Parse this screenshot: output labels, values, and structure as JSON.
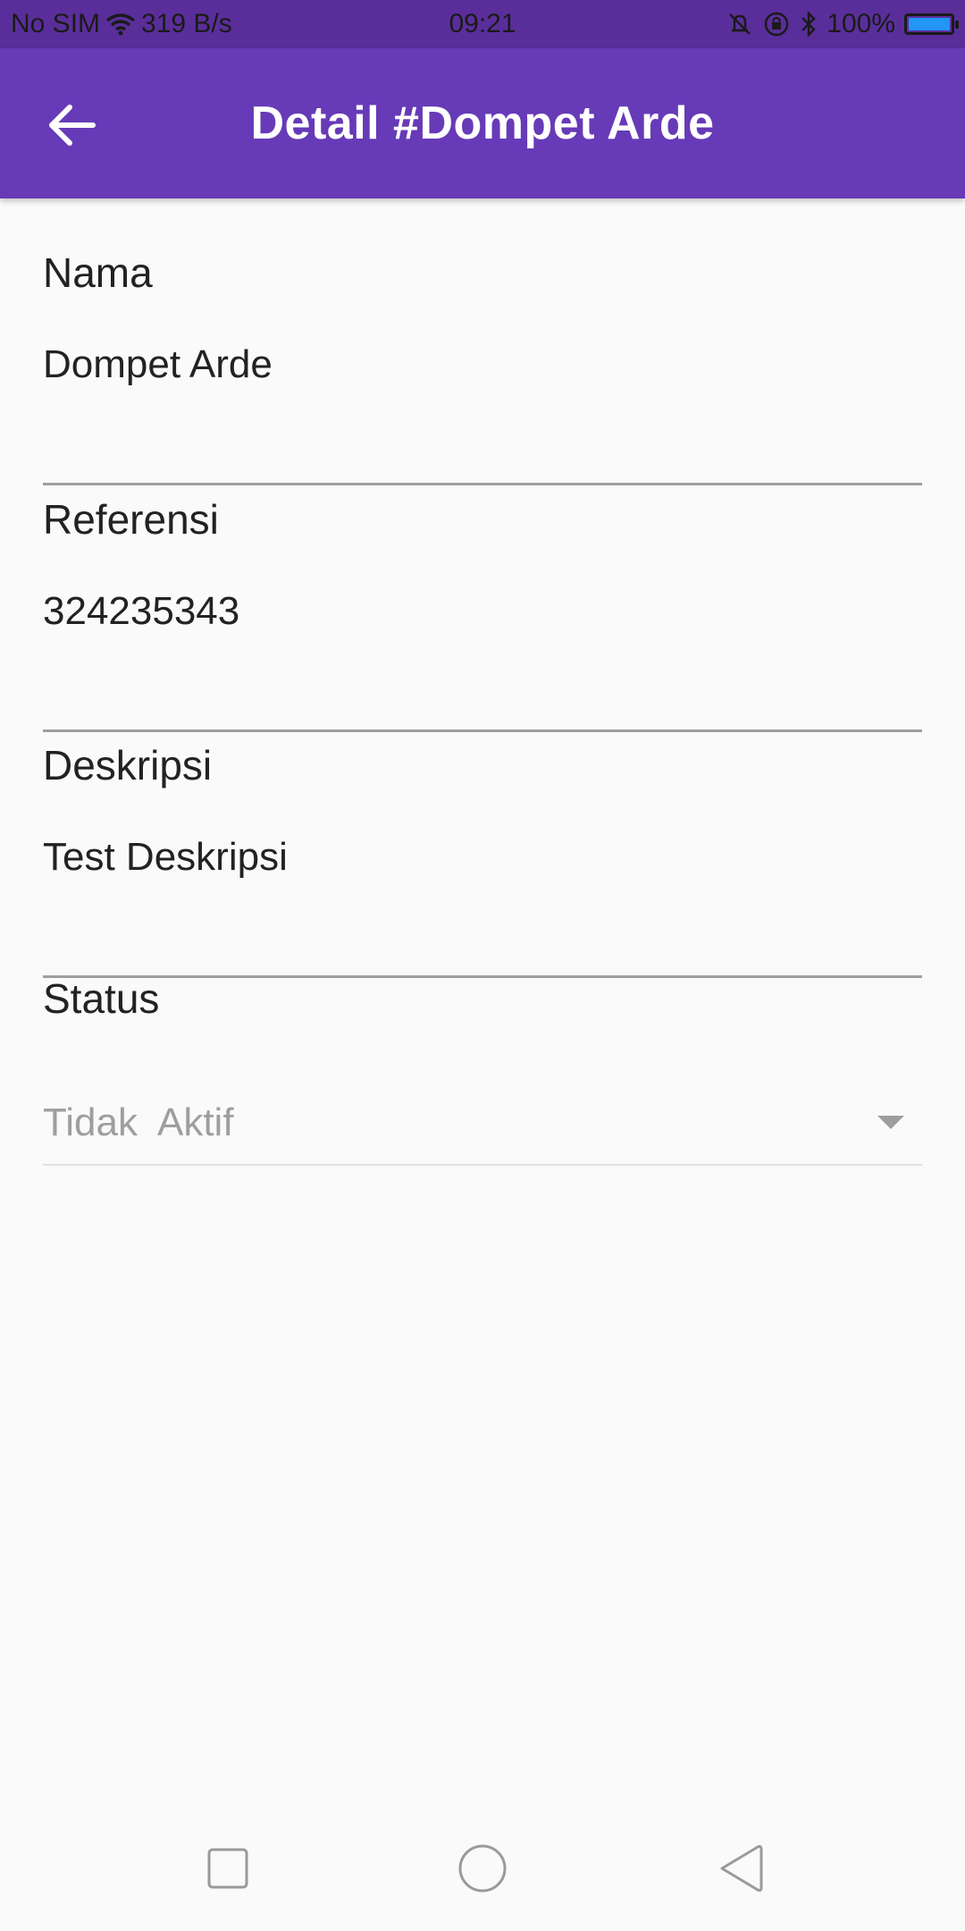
{
  "status_bar": {
    "carrier": "No SIM",
    "net_speed": "319 B/s",
    "time": "09:21",
    "battery": "100%",
    "battery_level": 1.0,
    "icons": [
      "wifi-icon",
      "alarm-off-icon",
      "rotation-lock-icon",
      "bluetooth-icon",
      "battery-icon"
    ]
  },
  "app_bar": {
    "title": "Detail #Dompet Arde",
    "back_icon": "arrow-left-icon",
    "color": "#673ab7"
  },
  "form": {
    "nama": {
      "label": "Nama",
      "value": "Dompet Arde"
    },
    "referensi": {
      "label": "Referensi",
      "value": "324235343"
    },
    "deskripsi": {
      "label": "Deskripsi",
      "value": "Test Deskripsi"
    },
    "status": {
      "label": "Status",
      "selected": "Tidak  Aktif",
      "arrow_icon": "dropdown-arrow-icon"
    }
  },
  "nav_bar": {
    "icons": [
      "recent-apps-icon",
      "home-icon",
      "back-triangle-icon"
    ]
  }
}
